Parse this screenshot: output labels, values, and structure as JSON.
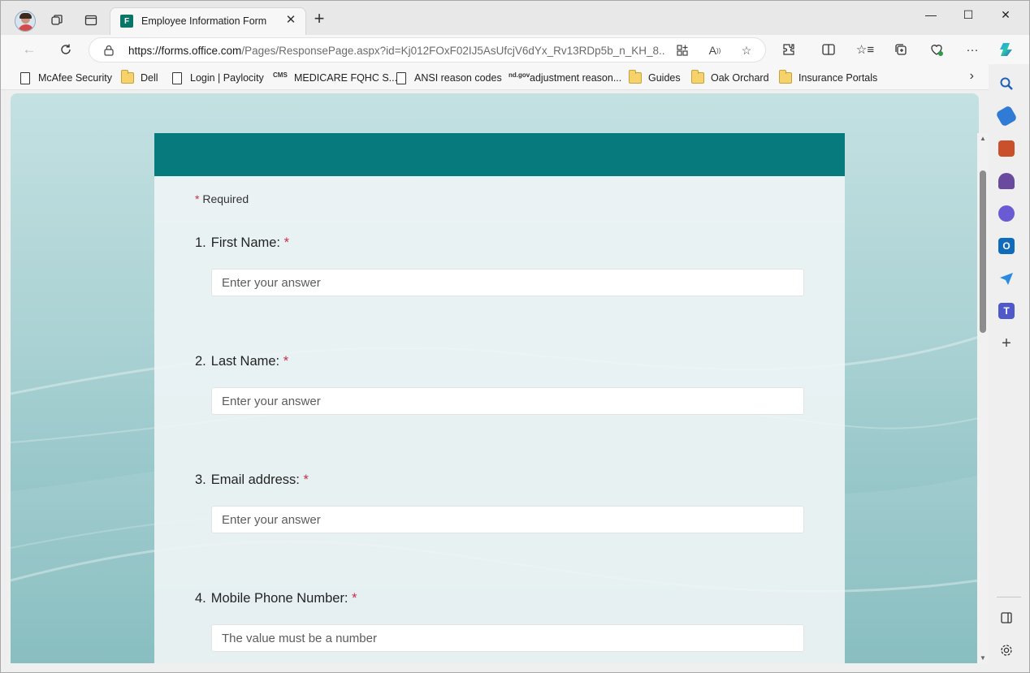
{
  "browser": {
    "tab_title": "Employee Information Form",
    "tab_favicon_letter": "F",
    "url_host": "https://forms.office.com",
    "url_path": "/Pages/ResponsePage.aspx?id=Kj012FOxF02IJ5AsUfcjV6dYx_Rv13RDp5b_n_KH_8..."
  },
  "bookmarks": [
    {
      "label": "McAfee Security",
      "icon": "page-icon"
    },
    {
      "label": "Dell",
      "icon": "folder-icon"
    },
    {
      "label": "Login | Paylocity",
      "icon": "page-icon"
    },
    {
      "label": "MEDICARE FQHC S...",
      "icon": "cms-icon"
    },
    {
      "label": "ANSI reason codes",
      "icon": "page-icon"
    },
    {
      "label": "adjustment reason...",
      "icon": "nd-gov-icon"
    },
    {
      "label": "Guides",
      "icon": "folder-icon"
    },
    {
      "label": "Oak Orchard",
      "icon": "folder-icon"
    },
    {
      "label": "Insurance Portals",
      "icon": "folder-icon"
    }
  ],
  "bookmark_icon_text": {
    "cms": "CMS",
    "nd": "nd.gov"
  },
  "form": {
    "required_star": "*",
    "required_label": "Required",
    "questions": [
      {
        "number": "1.",
        "label": "First Name:",
        "placeholder": "Enter your answer"
      },
      {
        "number": "2.",
        "label": "Last Name:",
        "placeholder": "Enter your answer"
      },
      {
        "number": "3.",
        "label": "Email address:",
        "placeholder": "Enter your answer"
      },
      {
        "number": "4.",
        "label": "Mobile Phone Number:",
        "placeholder": "The value must be a number"
      }
    ],
    "header_color": "#077a7e"
  }
}
